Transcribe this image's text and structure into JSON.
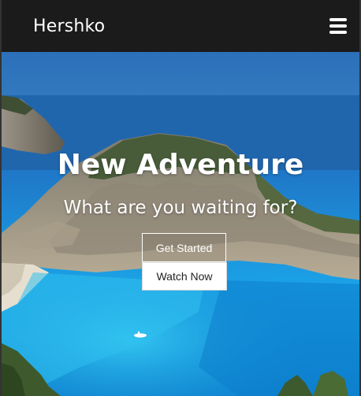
{
  "navbar": {
    "brand": "Hershko",
    "menu_icon": "hamburger-menu-icon"
  },
  "hero": {
    "title": "New Adventure",
    "subtitle": "What are you waiting for?",
    "primary_button": "Get Started",
    "secondary_button": "Watch Now"
  },
  "colors": {
    "navbar_bg": "#1b1b1b",
    "text": "#ffffff",
    "sea": "#1a8fd6",
    "sky": "#2a6fb8"
  }
}
